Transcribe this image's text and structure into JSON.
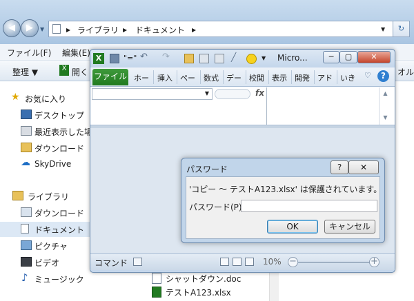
{
  "explorer": {
    "breadcrumb": [
      "ライブラリ",
      "ドキュメント"
    ],
    "menu": {
      "file": "ファイル(F)",
      "edit": "編集(E)"
    },
    "toolbar": {
      "organize": "整理 ▼",
      "open": "開く",
      "right_cut": "オル"
    },
    "sidebar": {
      "favorites_label": "お気に入り",
      "favorites": [
        "デスクトップ",
        "最近表示した場所",
        "ダウンロード",
        "SkyDrive"
      ],
      "libraries_label": "ライブラリ",
      "libraries": [
        "ダウンロード",
        "ドキュメント",
        "ピクチャ",
        "ビデオ",
        "ミュージック"
      ]
    },
    "files": [
      "シャットダウン.doc",
      "テストA123.xlsx"
    ]
  },
  "excel": {
    "title": "Micro...",
    "file_tab": "ファイル",
    "tabs": [
      "ホー",
      "挿入",
      "ペー",
      "数式",
      "デー",
      "校閲",
      "表示",
      "開発",
      "アド",
      "いき"
    ],
    "fx_label": "fx",
    "status": {
      "mode": "コマンド",
      "zoom": "10%"
    },
    "window_buttons": {
      "min": "─",
      "max": "▢",
      "close": "✕"
    }
  },
  "dialog": {
    "title": "パスワード",
    "message": "'コピー ～ テストA123.xlsx' は保護されています。",
    "password_label": "パスワード(P):",
    "password_value": "",
    "ok_label": "OK",
    "cancel_label": "キャンセル",
    "help_label": "?",
    "close_label": "✕"
  },
  "colors": {
    "excel_green": "#217a21",
    "chrome_blue": "#c4d6eb",
    "dialog_body": "#f0f0f0"
  }
}
